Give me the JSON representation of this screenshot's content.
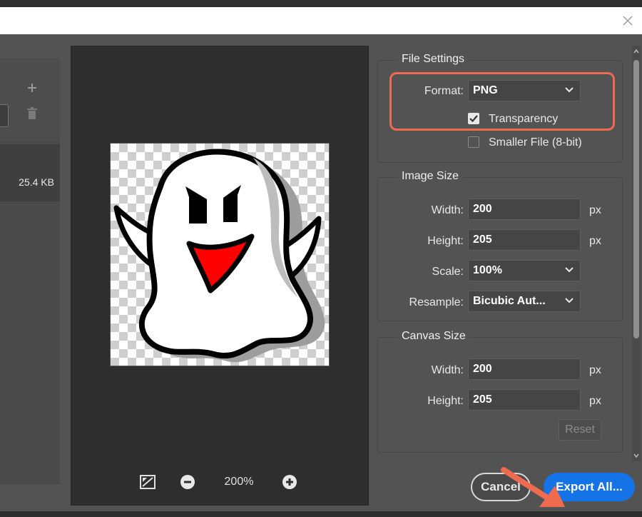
{
  "preview": {
    "zoom": "200%"
  },
  "left": {
    "file_size": "25.4 KB"
  },
  "file_settings": {
    "title": "File Settings",
    "format_label": "Format:",
    "format_value": "PNG",
    "transparency_label": "Transparency",
    "transparency_checked": true,
    "smaller_file_label": "Smaller File (8-bit)",
    "smaller_file_checked": false
  },
  "image_size": {
    "title": "Image Size",
    "width_label": "Width:",
    "width_value": "200",
    "height_label": "Height:",
    "height_value": "205",
    "scale_label": "Scale:",
    "scale_value": "100%",
    "resample_label": "Resample:",
    "resample_value": "Bicubic Aut...",
    "unit": "px"
  },
  "canvas_size": {
    "title": "Canvas Size",
    "width_label": "Width:",
    "width_value": "200",
    "height_label": "Height:",
    "height_value": "205",
    "unit": "px",
    "reset_label": "Reset"
  },
  "buttons": {
    "cancel": "Cancel",
    "export": "Export All..."
  },
  "colors": {
    "accent": "#1473e6",
    "highlight": "#ef6b50",
    "panel": "#535353"
  }
}
